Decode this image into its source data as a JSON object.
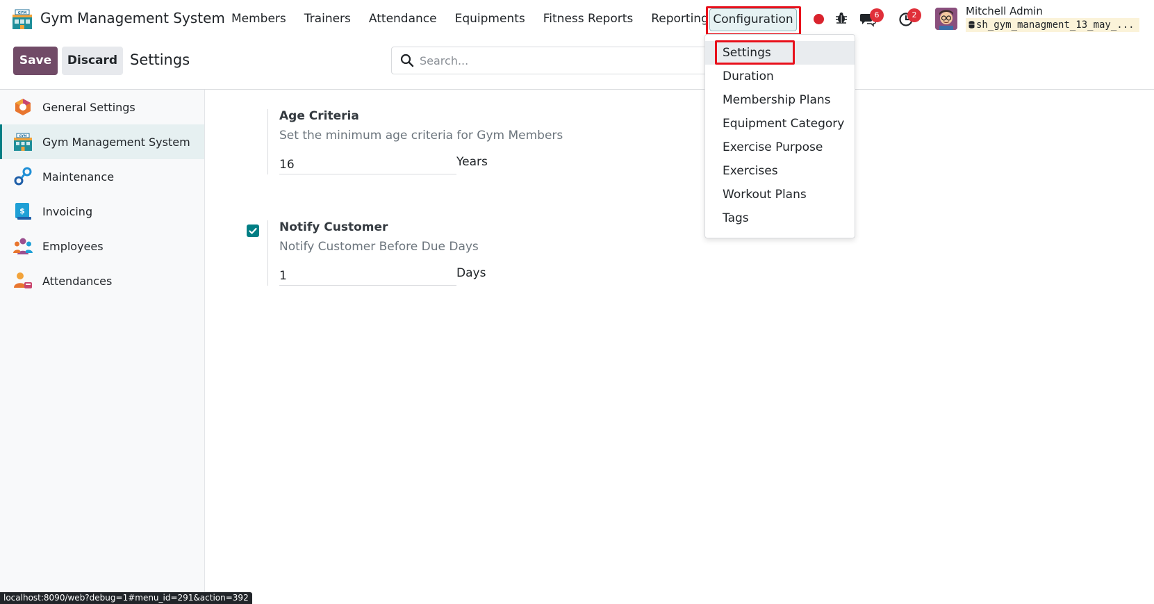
{
  "navbar": {
    "app_title": "Gym Management System",
    "menu": [
      "Members",
      "Trainers",
      "Attendance",
      "Equipments",
      "Fitness Reports",
      "Reporting"
    ],
    "configuration_label": "Configuration",
    "messages_count": "6",
    "activities_count": "2",
    "user_name": "Mitchell Admin",
    "db_name": "sh_gym_managment_13_may_..."
  },
  "control_panel": {
    "save_label": "Save",
    "discard_label": "Discard",
    "title": "Settings",
    "search_placeholder": "Search..."
  },
  "sidebar": {
    "items": [
      {
        "label": "General Settings",
        "icon": "odoo-icon",
        "active": false
      },
      {
        "label": "Gym Management System",
        "icon": "gym-icon",
        "active": true
      },
      {
        "label": "Maintenance",
        "icon": "maintenance-icon",
        "active": false
      },
      {
        "label": "Invoicing",
        "icon": "invoicing-icon",
        "active": false
      },
      {
        "label": "Employees",
        "icon": "employees-icon",
        "active": false
      },
      {
        "label": "Attendances",
        "icon": "attendances-icon",
        "active": false
      }
    ]
  },
  "settings": {
    "age": {
      "title": "Age Criteria",
      "description": "Set the minimum age criteria for Gym Members",
      "value": "16",
      "unit": "Years"
    },
    "notify": {
      "title": "Notify Customer",
      "description": "Notify Customer Before Due Days",
      "value": "1",
      "unit": "Days",
      "checked": true
    }
  },
  "dropdown": {
    "items": [
      "Settings",
      "Duration",
      "Membership Plans",
      "Equipment Category",
      "Exercise Purpose",
      "Exercises",
      "Workout Plans",
      "Tags"
    ]
  },
  "status_url": "localhost:8090/web?debug=1#menu_id=291&action=392",
  "colors": {
    "primary": "#714b67",
    "accent": "#017e84",
    "highlight": "#e8101b"
  }
}
